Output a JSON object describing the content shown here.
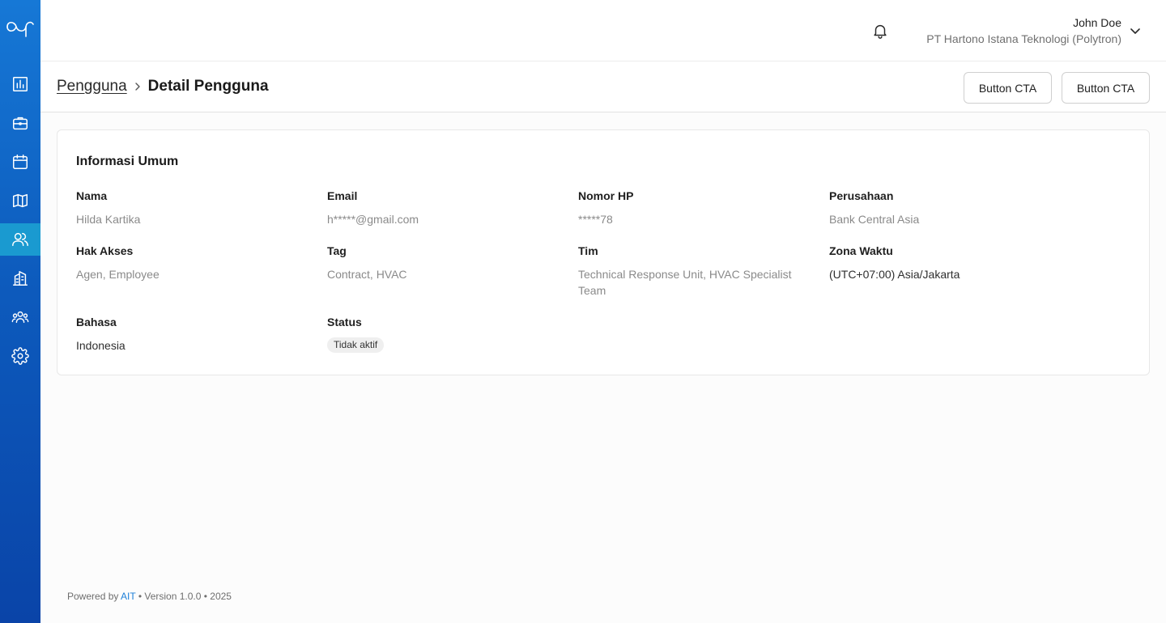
{
  "sidebar": {
    "logo": "app-logo",
    "items": [
      {
        "icon": "chart-icon",
        "active": false
      },
      {
        "icon": "briefcase-icon",
        "active": false
      },
      {
        "icon": "calendar-icon",
        "active": false
      },
      {
        "icon": "map-icon",
        "active": false
      },
      {
        "icon": "users-icon",
        "active": true
      },
      {
        "icon": "building-icon",
        "active": false
      },
      {
        "icon": "team-icon",
        "active": false
      },
      {
        "icon": "gear-icon",
        "active": false
      }
    ]
  },
  "header": {
    "user_name": "John Doe",
    "company": "PT Hartono Istana Teknologi (Polytron)"
  },
  "breadcrumb": {
    "parent": "Pengguna",
    "current": "Detail Pengguna"
  },
  "actions": {
    "cta_1": "Button CTA",
    "cta_2": "Button CTA"
  },
  "general_info": {
    "title": "Informasi Umum",
    "nama": {
      "label": "Nama",
      "value": "Hilda Kartika"
    },
    "email": {
      "label": "Email",
      "value": "h*****@gmail.com"
    },
    "nomor_hp": {
      "label": "Nomor HP",
      "value": "*****78"
    },
    "perusahaan": {
      "label": "Perusahaan",
      "value": "Bank Central Asia"
    },
    "hak_akses": {
      "label": "Hak Akses",
      "value": "Agen, Employee"
    },
    "tag": {
      "label": "Tag",
      "value": "Contract, HVAC"
    },
    "tim": {
      "label": "Tim",
      "value": "Technical Response Unit, HVAC Specialist Team"
    },
    "zona_waktu": {
      "label": "Zona Waktu",
      "value": "(UTC+07:00) Asia/Jakarta"
    },
    "bahasa": {
      "label": "Bahasa",
      "value": "Indonesia"
    },
    "status": {
      "label": "Status",
      "value": "Tidak aktif"
    }
  },
  "footer": {
    "powered_by": "Powered by ",
    "brand": "AIT",
    "version": " • Version 1.0.0 • 2025"
  },
  "colors": {
    "sidebar_top": "#1678d6",
    "sidebar_bottom": "#0a44a8",
    "active_nav": "#1a9ad0",
    "link": "#1d7fd8"
  }
}
